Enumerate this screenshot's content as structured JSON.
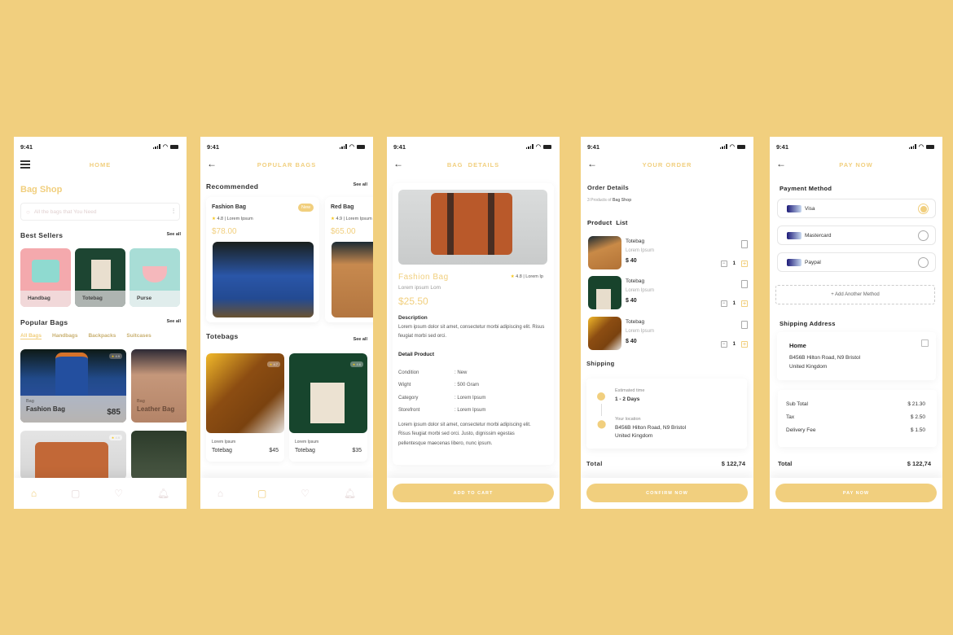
{
  "status_time": "9:41",
  "screens": {
    "home": {
      "title": "HOME",
      "shop_name": "Bag Shop",
      "search_placeholder": "All the bags that You Need",
      "best_sellers": {
        "title": "Best Sellers",
        "see_all": "See all",
        "items": [
          "Handbag",
          "Totebag",
          "Purse"
        ]
      },
      "popular": {
        "title": "Popular Bags",
        "see_all": "See all",
        "tabs": [
          "All Bags",
          "Handbags",
          "Backpacks",
          "Suitcases"
        ],
        "active_tab": "All Bags",
        "cards": [
          {
            "category": "Bag",
            "name": "Fashion Bag",
            "price": "$85",
            "rating": "4.9"
          },
          {
            "category": "Bag",
            "name": "Leather Bag",
            "price": "",
            "rating": ""
          },
          {
            "category": "",
            "name": "",
            "price": "",
            "rating": "4.9"
          }
        ]
      }
    },
    "popular": {
      "title": "POPULAR BAGS",
      "recommended": {
        "title": "Recommended",
        "see_all": "See all",
        "items": [
          {
            "name": "Fashion Bag",
            "rating": "4.8 | Lorem Ipsum",
            "price": "$78.00",
            "badge": "New"
          },
          {
            "name": "Red Bag",
            "rating": "4.9 | Lorem Ipsum",
            "price": "$65.00"
          }
        ]
      },
      "totebags": {
        "title": "Totebags",
        "see_all": "See all",
        "items": [
          {
            "sub": "Lorem Ipsum",
            "name": "Totebag",
            "price": "$45",
            "rating": "4.7"
          },
          {
            "sub": "Lorem Ipsum",
            "name": "Totebag",
            "price": "$35",
            "rating": "4.6"
          }
        ]
      }
    },
    "details": {
      "title": "BAG  DETAILS",
      "name": "Fashion Bag",
      "rating": "4.8 | Lorem Ip",
      "subtitle": "Lorem ipsum Lom",
      "price": "$25.50",
      "description_title": "Description",
      "description": "Lorem ipsum dolor sit amet, consectetur morbi adipiscing elit. Risus feugiat morbi sed orci.",
      "detail_title": "Detail Product",
      "specs": [
        {
          "k": "Condition",
          "v": ": New"
        },
        {
          "k": "Wight",
          "v": ": 500 Gram"
        },
        {
          "k": "Category",
          "v": ": Lorem Ipsum"
        },
        {
          "k": "Storefront",
          "v": ": Lorem Ipsum"
        }
      ],
      "long_text": "Lorem ipsum dolor sit amet, consectetur morbi adipiscing elit. Risus feugiat morbi sed orci. Justo, dignissim egestas pellentesque maecenas libero, nunc ipsum.",
      "button": "ADD TO CART"
    },
    "order": {
      "title": "YOUR ORDER",
      "order_details": "Order Details",
      "order_sub_prefix": "3 Products of ",
      "order_sub_shop": "Bag Shop",
      "product_list": "Product  List",
      "products": [
        {
          "name": "Totebag",
          "sub": "Lorem Ipsum",
          "price": "$ 40",
          "qty": "1"
        },
        {
          "name": "Totebag",
          "sub": "Lorem Ipsum",
          "price": "$ 40",
          "qty": "1"
        },
        {
          "name": "Totebag",
          "sub": "Lorem Ipsum",
          "price": "$ 40",
          "qty": "1"
        }
      ],
      "shipping": "Shipping",
      "est_label": "Estimated time",
      "est_value": "1 - 2 Days",
      "loc_label": "Your location",
      "loc_line1": "B456B Hilton Road, N9 Bristol",
      "loc_line2": "United Kingdom",
      "total_label": "Total",
      "total_value": "$ 122,74",
      "button": "CONFIRM NOW"
    },
    "pay": {
      "title": "PAY NOW",
      "method_title": "Payment Method",
      "methods": [
        {
          "name": "Visa",
          "selected": true
        },
        {
          "name": "Mastercard",
          "selected": false
        },
        {
          "name": "Paypal",
          "selected": false
        }
      ],
      "add_method": "+ Add Another Method",
      "address_title": "Shipping Address",
      "address_name": "Home",
      "address_line1": "B456B Hilton Road, N9 Bristol",
      "address_line2": "United Kingdom",
      "summary": [
        {
          "k": "Sub Total",
          "v": "$ 21.30"
        },
        {
          "k": "Tax",
          "v": "$ 2.50"
        },
        {
          "k": "Delivery Fee",
          "v": "$ 1.50"
        }
      ],
      "total_label": "Total",
      "total_value": "$ 122,74",
      "button": "PAY NOW"
    }
  },
  "colors": {
    "accent": "#f1cf7e",
    "background": "#f1cf7e"
  }
}
